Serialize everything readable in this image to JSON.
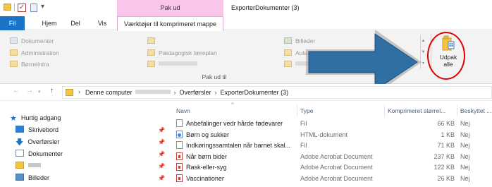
{
  "window": {
    "context_group": "Pak ud",
    "title": "ExporterDokumenter (3)"
  },
  "tabs": {
    "fil": "Fil",
    "hjem": "Hjem",
    "del": "Del",
    "vis": "Vis",
    "tools": "Værktøjer til komprimeret mappe"
  },
  "ribbon": {
    "col1": [
      "Dokumenter",
      "Administration",
      "Børneintra"
    ],
    "col2": [
      "Pædagogisk læreplan"
    ],
    "col3": [
      "Billeder",
      "Aula"
    ],
    "udpak_label": "Udpak\nalle",
    "group_label": "Pak ud til"
  },
  "address": {
    "crumbs": [
      "Denne computer",
      "Overførsler",
      "ExporterDokumenter (3)"
    ]
  },
  "navpane": {
    "quick_access": "Hurtig adgang",
    "items": [
      "Skrivebord",
      "Overførsler",
      "Dokumenter",
      "Billeder"
    ]
  },
  "columns": {
    "name": "Navn",
    "type": "Type",
    "size": "Komprimeret størrel...",
    "protected": "Beskyttet ..."
  },
  "files": [
    {
      "name": "Anbefalinger vedr hårde fødevarer",
      "type": "Fil",
      "size": "66 KB",
      "protected": "Nej",
      "icon": "file-icon"
    },
    {
      "name": "Børn og sukker",
      "type": "HTML-dokument",
      "size": "1 KB",
      "protected": "Nej",
      "icon": "html-file-icon"
    },
    {
      "name": "Indkøringssamtalen når barnet skal...",
      "type": "Fil",
      "size": "71 KB",
      "protected": "Nej",
      "icon": "file-icon"
    },
    {
      "name": "Når børn bider",
      "type": "Adobe Acrobat Document",
      "size": "237 KB",
      "protected": "Nej",
      "icon": "pdf-file-icon"
    },
    {
      "name": "Rask-eller-syg",
      "type": "Adobe Acrobat Document",
      "size": "122 KB",
      "protected": "Nej",
      "icon": "pdf-file-icon"
    },
    {
      "name": "Vaccinationer",
      "type": "Adobe Acrobat Document",
      "size": "26 KB",
      "protected": "Nej",
      "icon": "pdf-file-icon"
    }
  ],
  "colors": {
    "file_tab": "#1a73c7",
    "context_pink": "#f9c6ea",
    "annotation_arrow": "#2f6fa3",
    "annotation_circle": "#e00000"
  }
}
